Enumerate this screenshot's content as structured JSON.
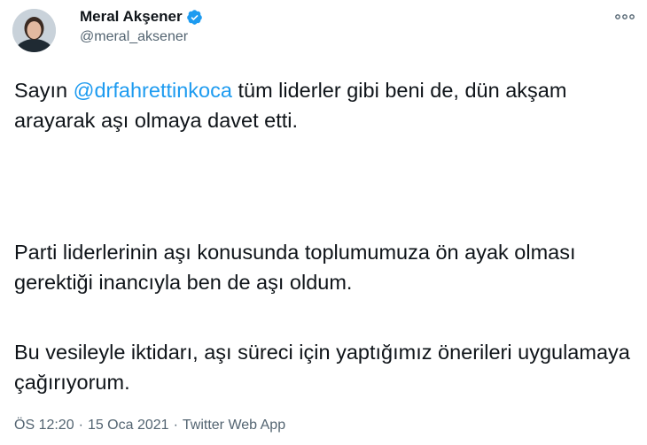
{
  "author": {
    "name": "Meral Akşener",
    "handle": "@meral_aksener",
    "verified": true
  },
  "tweet": {
    "paragraph1": {
      "prefix": "Sayın ",
      "mention": "@drfahrettinkoca",
      "suffix": " tüm liderler gibi beni de, dün akşam arayarak aşı olmaya davet etti."
    },
    "paragraph2": "Parti liderlerinin aşı konusunda toplumumuza ön ayak olması gerektiği inancıyla ben de aşı oldum.",
    "paragraph3": "Bu vesileyle iktidarı, aşı süreci için yaptığımız önerileri uygulamaya çağırıyorum."
  },
  "meta": {
    "time": "ÖS 12:20",
    "date": "15 Oca 2021",
    "source": "Twitter Web App",
    "separator": "·"
  },
  "icons": {
    "verified": "verified-badge-icon",
    "more": "more-options-icon"
  },
  "colors": {
    "accent": "#1d9bf0",
    "text": "#0f1419",
    "secondary": "#536471"
  }
}
